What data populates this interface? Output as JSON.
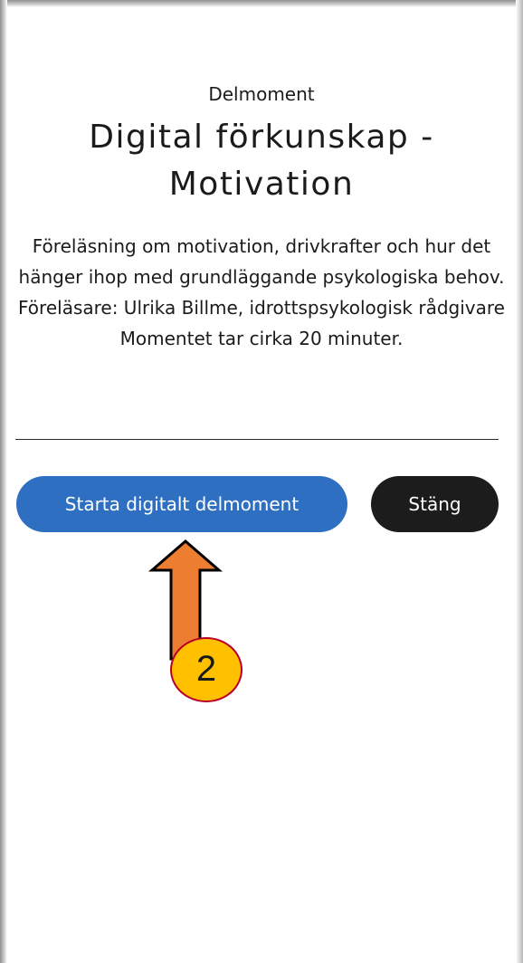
{
  "module": {
    "kicker": "Delmoment",
    "title": "Digital förkunskap - Motivation",
    "description": "Föreläsning om motivation, drivkrafter och hur det hänger ihop med grundläggande psykologiska behov. Föreläsare: Ulrika Billme, idrottspsykologisk rådgivare Momentet tar cirka 20 minuter."
  },
  "actions": {
    "start_label": "Starta digitalt delmoment",
    "close_label": "Stäng"
  },
  "annotation": {
    "step_number": "2",
    "arrow_color": "#ed7d31",
    "badge_color": "#ffc000"
  },
  "colors": {
    "primary_button": "#2e6fc2",
    "secondary_button": "#1c1c1c"
  }
}
